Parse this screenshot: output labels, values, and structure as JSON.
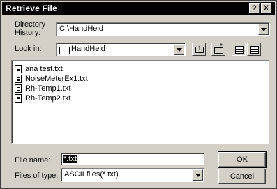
{
  "window": {
    "title": "Retrieve File",
    "help_label": "?",
    "close_label": "X"
  },
  "directory_history": {
    "label_line1": "Directory",
    "label_line2": "History:",
    "value": "C:\\HandHeld"
  },
  "look_in": {
    "label": "Look in:",
    "value": "HandHeld",
    "icons": [
      "up-folder-icon",
      "new-folder-icon",
      "list-view-icon",
      "details-view-icon"
    ]
  },
  "files": [
    {
      "name": "ana test.txt"
    },
    {
      "name": "NoiseMeterEx1.txt"
    },
    {
      "name": "Rh-Temp1.txt"
    },
    {
      "name": "Rh-Temp2.txt"
    }
  ],
  "file_name": {
    "label": "File name:",
    "value": "*.txt"
  },
  "files_of_type": {
    "label": "Files of type:",
    "value": "ASCII files(*.txt)"
  },
  "buttons": {
    "ok": "OK",
    "cancel": "Cancel"
  }
}
